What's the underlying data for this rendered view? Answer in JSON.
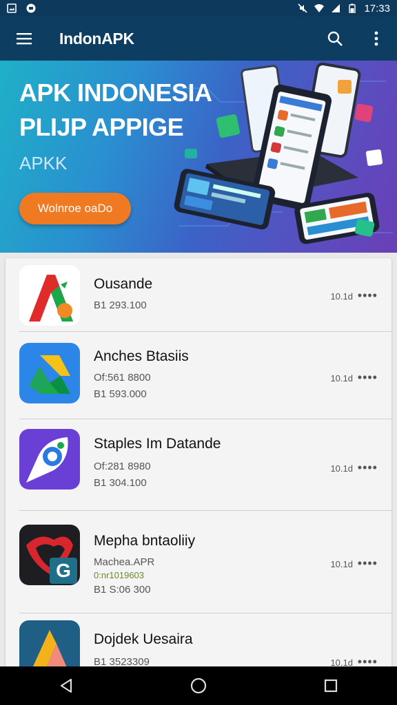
{
  "status_bar": {
    "time": "17:33",
    "icons": [
      "image-icon",
      "notification-icon",
      "no-sound-icon",
      "wifi-icon",
      "signal-icon",
      "battery-icon"
    ]
  },
  "app_bar": {
    "title": "IndonAPK",
    "icons": [
      "menu-icon",
      "search-icon",
      "more-vert-icon"
    ]
  },
  "banner": {
    "line1": "APK INDONESIA",
    "line2": "PLIJP APPIGE",
    "subtitle": "APKK",
    "cta_label": "Wolnroe oaDo"
  },
  "apps": [
    {
      "name": "Ousande",
      "meta1": "B1 293.100",
      "meta2": "",
      "meta3": "",
      "size": "10.1d",
      "more": "••••"
    },
    {
      "name": "Anches Btasiis",
      "meta1": "Of:561 8800",
      "meta2": "B1 593.000",
      "meta3": "",
      "size": "10.1d",
      "more": "••••"
    },
    {
      "name": "Staples Im Datande",
      "meta1": "Of:281 8980",
      "meta2": "B1 304.100",
      "meta3": "",
      "size": "10.1d",
      "more": "••••"
    },
    {
      "name": "Mepha bntaoliiy",
      "meta1": "Machea.APR",
      "meta2": "0:nr1019603",
      "meta3": "B1 S:06 300",
      "size": "10.1d",
      "more": "••••"
    },
    {
      "name": "Dojdek Uesaira",
      "meta1": "B1 3523309",
      "meta2": "",
      "meta3": "",
      "size": "10.1d",
      "more": "••••"
    }
  ],
  "colors": {
    "app_bar": "#0d3d60",
    "cta": "#f07a22",
    "accent": "#2a8fd0"
  }
}
